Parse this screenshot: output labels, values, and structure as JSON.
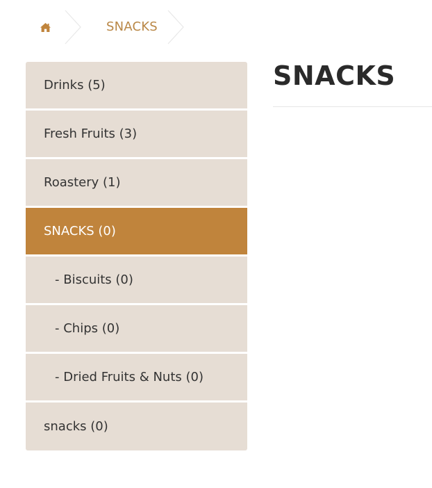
{
  "breadcrumb": {
    "home_icon": "home-icon",
    "current_label": "SNACKS"
  },
  "sidebar": {
    "items": [
      {
        "label": "Drinks (5)"
      },
      {
        "label": "Fresh Fruits (3)"
      },
      {
        "label": "Roastery (1)"
      },
      {
        "label": "SNACKS (0)",
        "active": true
      },
      {
        "label": "- Biscuits (0)",
        "sub": true
      },
      {
        "label": "- Chips (0)",
        "sub": true
      },
      {
        "label": "- Dried Fruits & Nuts (0)",
        "sub": true
      },
      {
        "label": "snacks (0)"
      }
    ]
  },
  "main": {
    "title": "SNACKS"
  },
  "colors": {
    "accent": "#c0843c",
    "breadcrumb_text": "#b98746",
    "sidebar_bg": "#e6ddd4",
    "text": "#333333"
  }
}
